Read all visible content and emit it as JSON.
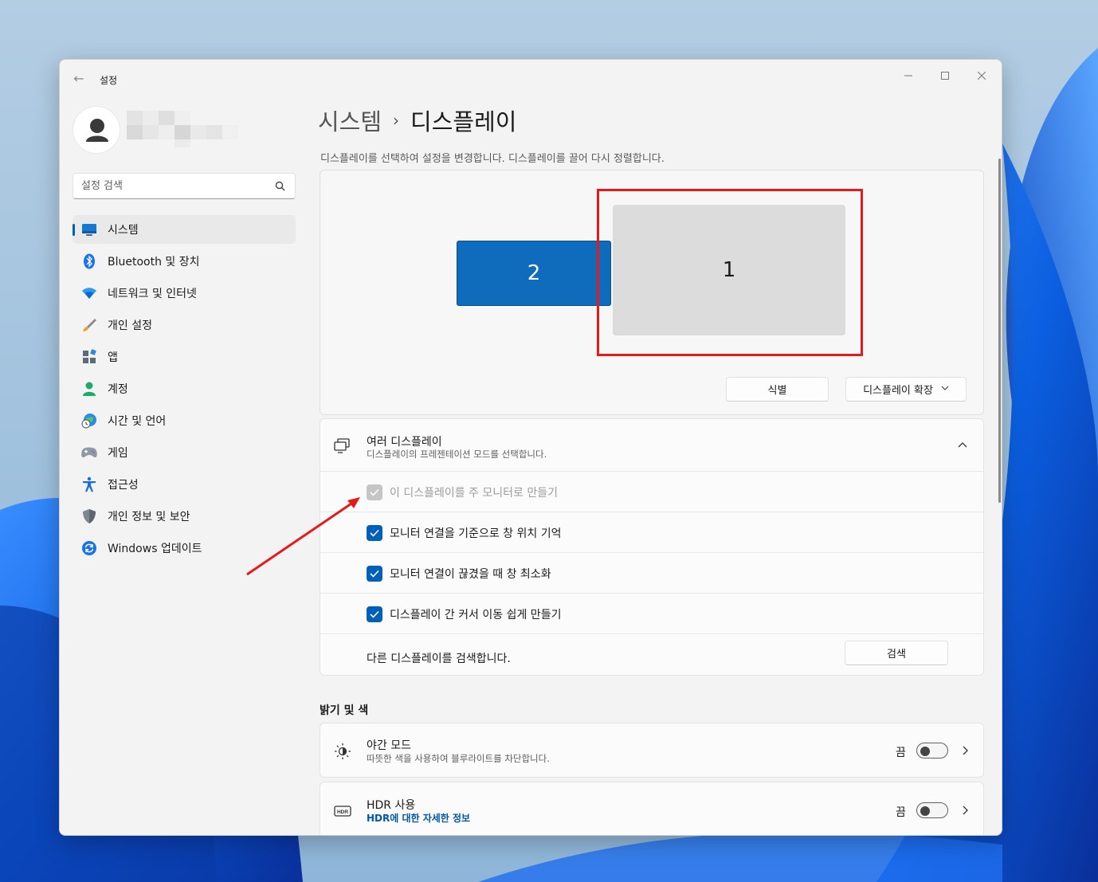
{
  "window": {
    "app_title": "설정"
  },
  "search": {
    "placeholder": "설정 검색"
  },
  "sidebar": {
    "items": [
      {
        "label": "시스템"
      },
      {
        "label": "Bluetooth 및 장치"
      },
      {
        "label": "네트워크 및 인터넷"
      },
      {
        "label": "개인 설정"
      },
      {
        "label": "앱"
      },
      {
        "label": "계정"
      },
      {
        "label": "시간 및 언어"
      },
      {
        "label": "게임"
      },
      {
        "label": "접근성"
      },
      {
        "label": "개인 정보 및 보안"
      },
      {
        "label": "Windows 업데이트"
      }
    ]
  },
  "breadcrumb": {
    "parent": "시스템",
    "separator": "›",
    "current": "디스플레이"
  },
  "arrange": {
    "description": "디스플레이를 선택하여 설정을 변경합니다. 디스플레이를 끌어 다시 정렬합니다.",
    "monitor_1": "1",
    "monitor_2": "2",
    "identify_label": "식별",
    "extend_label": "디스플레이 확장"
  },
  "multi": {
    "title": "여러 디스플레이",
    "subtitle": "디스플레이의 프레젠테이션 모드를 선택합니다.",
    "options": [
      {
        "label": "이 디스플레이를 주 모니터로 만들기",
        "checked": true,
        "disabled": true
      },
      {
        "label": "모니터 연결을 기준으로 창 위치 기억",
        "checked": true,
        "disabled": false
      },
      {
        "label": "모니터 연결이 끊겼을 때 창 최소화",
        "checked": true,
        "disabled": false
      },
      {
        "label": "디스플레이 간 커서 이동 쉽게 만들기",
        "checked": true,
        "disabled": false
      }
    ],
    "detect_text": "다른 디스플레이를 검색합니다.",
    "detect_button": "검색"
  },
  "brightness": {
    "section_title": "밝기 및 색",
    "night": {
      "title": "야간 모드",
      "subtitle": "따뜻한 색을 사용하여 블루라이트를 차단합니다.",
      "state": "끔"
    },
    "hdr": {
      "title": "HDR 사용",
      "link": "HDR에 대한 자세한 정보",
      "state": "끔"
    }
  },
  "colors": {
    "accent": "#005fb8",
    "highlight": "#e51a1a",
    "monitor_selected": "#0f6cbd"
  }
}
